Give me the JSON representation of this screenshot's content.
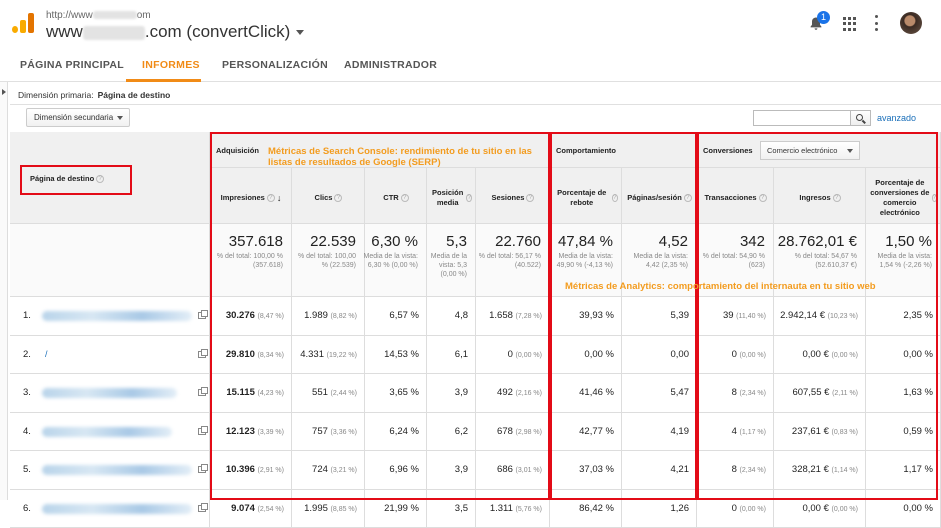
{
  "header": {
    "url_prefix": "http://www",
    "url_suffix": "om",
    "site_prefix": "www",
    "site_suffix": ".com (convertClick)",
    "notifications": "1"
  },
  "tabs": [
    "PÁGINA PRINCIPAL",
    "INFORMES",
    "PERSONALIZACIÓN",
    "ADMINISTRADOR"
  ],
  "active_tab": "INFORMES",
  "dimension": {
    "label": "Dimensión primaria:",
    "value": "Página de destino"
  },
  "secondary_dimension": "Dimensión secundaria",
  "search": {
    "value": "",
    "advanced": "avanzado"
  },
  "table": {
    "page_header": "Página de destino",
    "groups": {
      "acquisition": "Adquisición",
      "behavior": "Comportamiento",
      "conversions": "Conversiones",
      "conversion_select": "Comercio electrónico"
    },
    "columns": [
      {
        "key": "impressions",
        "label": "Impresiones"
      },
      {
        "key": "clicks",
        "label": "Clics"
      },
      {
        "key": "ctr",
        "label": "CTR"
      },
      {
        "key": "position",
        "label": "Posición media"
      },
      {
        "key": "sessions",
        "label": "Sesiones"
      },
      {
        "key": "bounce",
        "label": "Porcentaje de rebote"
      },
      {
        "key": "pages",
        "label": "Páginas/sesión"
      },
      {
        "key": "transactions",
        "label": "Transacciones"
      },
      {
        "key": "revenue",
        "label": "Ingresos"
      },
      {
        "key": "conv_rate",
        "label": "Porcentaje de conversiones de comercio electrónico"
      }
    ],
    "totals": {
      "impressions": {
        "big": "357.618",
        "small": "% del total: 100,00 % (357.618)"
      },
      "clicks": {
        "big": "22.539",
        "small": "% del total: 100,00 % (22.539)"
      },
      "ctr": {
        "big": "6,30 %",
        "small": "Media de la vista: 6,30 % (0,00 %)"
      },
      "position": {
        "big": "5,3",
        "small": "Media de la vista: 5,3 (0,00 %)"
      },
      "sessions": {
        "big": "22.760",
        "small": "% del total: 56,17 % (40.522)"
      },
      "bounce": {
        "big": "47,84 %",
        "small": "Media de la vista: 49,90 % (-4,13 %)"
      },
      "pages": {
        "big": "4,52",
        "small": "Media de la vista: 4,42 (2,35 %)"
      },
      "transactions": {
        "big": "342",
        "small": "% del total: 54,90 % (623)"
      },
      "revenue": {
        "big": "28.762,01 €",
        "small": "% del total: 54,67 % (52.610,37 €)"
      },
      "conv_rate": {
        "big": "1,50 %",
        "small": "Media de la vista: 1,54 % (-2,26 %)"
      }
    },
    "rows": [
      {
        "num": "1.",
        "page": "",
        "impressions": "30.276",
        "impressions_pct": "(8,47 %)",
        "clicks": "1.989",
        "clicks_pct": "(8,82 %)",
        "ctr": "6,57 %",
        "position": "4,8",
        "sessions": "1.658",
        "sessions_pct": "(7,28 %)",
        "bounce": "39,93 %",
        "pages": "5,39",
        "transactions": "39",
        "transactions_pct": "(11,40 %)",
        "revenue": "2.942,14 €",
        "revenue_pct": "(10,23 %)",
        "conv_rate": "2,35 %"
      },
      {
        "num": "2.",
        "page": "/",
        "impressions": "29.810",
        "impressions_pct": "(8,34 %)",
        "clicks": "4.331",
        "clicks_pct": "(19,22 %)",
        "ctr": "14,53 %",
        "position": "6,1",
        "sessions": "0",
        "sessions_pct": "(0,00 %)",
        "bounce": "0,00 %",
        "pages": "0,00",
        "transactions": "0",
        "transactions_pct": "(0,00 %)",
        "revenue": "0,00 €",
        "revenue_pct": "(0,00 %)",
        "conv_rate": "0,00 %"
      },
      {
        "num": "3.",
        "page": "",
        "impressions": "15.115",
        "impressions_pct": "(4,23 %)",
        "clicks": "551",
        "clicks_pct": "(2,44 %)",
        "ctr": "3,65 %",
        "position": "3,9",
        "sessions": "492",
        "sessions_pct": "(2,16 %)",
        "bounce": "41,46 %",
        "pages": "5,47",
        "transactions": "8",
        "transactions_pct": "(2,34 %)",
        "revenue": "607,55 €",
        "revenue_pct": "(2,11 %)",
        "conv_rate": "1,63 %"
      },
      {
        "num": "4.",
        "page": "",
        "impressions": "12.123",
        "impressions_pct": "(3,39 %)",
        "clicks": "757",
        "clicks_pct": "(3,36 %)",
        "ctr": "6,24 %",
        "position": "6,2",
        "sessions": "678",
        "sessions_pct": "(2,98 %)",
        "bounce": "42,77 %",
        "pages": "4,19",
        "transactions": "4",
        "transactions_pct": "(1,17 %)",
        "revenue": "237,61 €",
        "revenue_pct": "(0,83 %)",
        "conv_rate": "0,59 %"
      },
      {
        "num": "5.",
        "page": "",
        "impressions": "10.396",
        "impressions_pct": "(2,91 %)",
        "clicks": "724",
        "clicks_pct": "(3,21 %)",
        "ctr": "6,96 %",
        "position": "3,9",
        "sessions": "686",
        "sessions_pct": "(3,01 %)",
        "bounce": "37,03 %",
        "pages": "4,21",
        "transactions": "8",
        "transactions_pct": "(2,34 %)",
        "revenue": "328,21 €",
        "revenue_pct": "(1,14 %)",
        "conv_rate": "1,17 %"
      },
      {
        "num": "6.",
        "page": "",
        "impressions": "9.074",
        "impressions_pct": "(2,54 %)",
        "clicks": "1.995",
        "clicks_pct": "(8,85 %)",
        "ctr": "21,99 %",
        "position": "3,5",
        "sessions": "1.311",
        "sessions_pct": "(5,76 %)",
        "bounce": "86,42 %",
        "pages": "1,26",
        "transactions": "0",
        "transactions_pct": "(0,00 %)",
        "revenue": "0,00 €",
        "revenue_pct": "(0,00 %)",
        "conv_rate": "0,00 %"
      }
    ]
  },
  "annotations": {
    "search_console": "Métricas de Search Console: rendimiento de tu sitio en las listas de resultados de Google (SERP)",
    "analytics": "Métricas de Analytics: comportamiento del internauta en tu sitio web"
  },
  "colors": {
    "accent": "#f18b17",
    "annotation_red": "#e30b17",
    "annotation_orange": "#f39c1f",
    "link": "#1a6fb9"
  }
}
